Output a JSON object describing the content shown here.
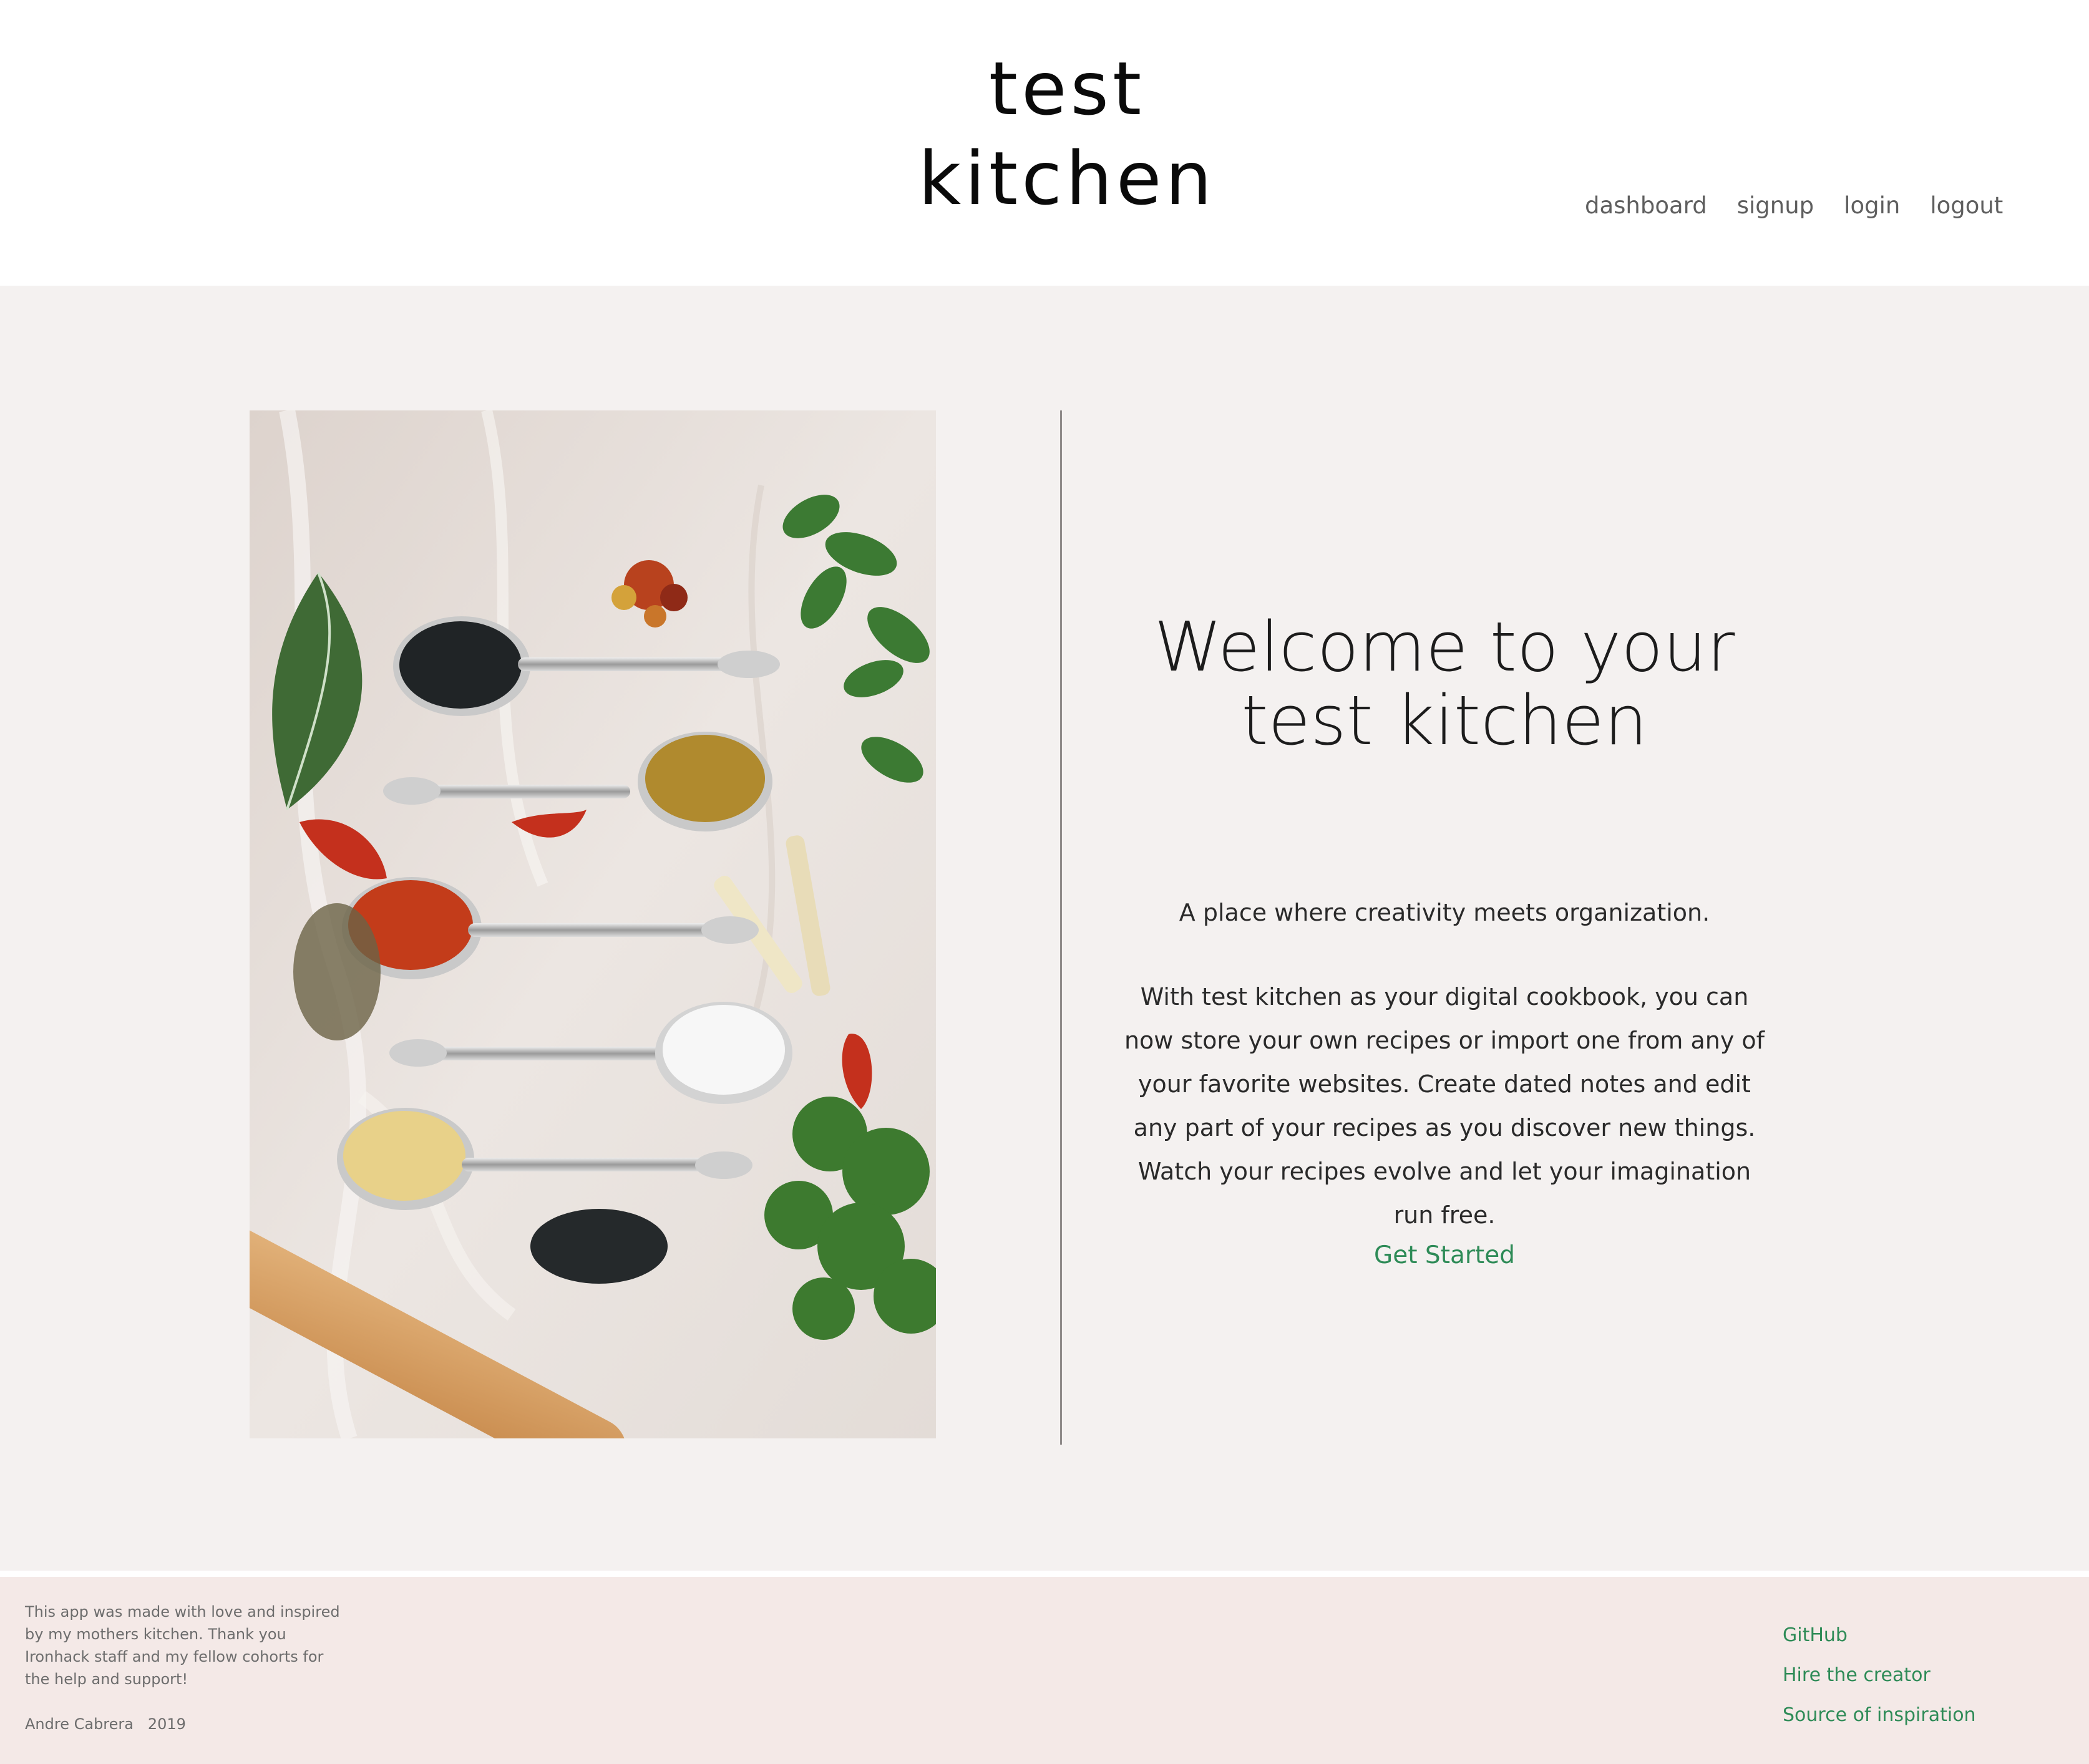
{
  "header": {
    "brand_line1": "test",
    "brand_line2": "kitchen",
    "nav": [
      {
        "label": "dashboard"
      },
      {
        "label": "signup"
      },
      {
        "label": "login"
      },
      {
        "label": "logout"
      }
    ]
  },
  "hero": {
    "image": {
      "subject": "spices-on-spoons-photo"
    },
    "title_line1": "Welcome to your",
    "title_line2": "test kitchen",
    "tagline": "A place where creativity meets organization.",
    "description": "With test kitchen as your digital cookbook, you can now store your own recipes or import one from any of your favorite websites. Create dated notes and edit any part of your recipes as you discover new things. Watch your recipes evolve and let your imagination run free.",
    "cta_label": "Get Started"
  },
  "footer": {
    "about": "This app was made with love and inspired by my mothers kitchen. Thank you Ironhack staff and my fellow cohorts for the help and support!",
    "author": "Andre Cabrera",
    "year": "2019",
    "links": [
      {
        "label": "GitHub"
      },
      {
        "label": "Hire the creator"
      },
      {
        "label": "Source of inspiration"
      }
    ]
  },
  "colors": {
    "page_bg": "#f4f1f0",
    "footer_bg": "#f4e9e7",
    "accent_green": "#2e8b57",
    "nav_text": "#5f5f5f"
  }
}
